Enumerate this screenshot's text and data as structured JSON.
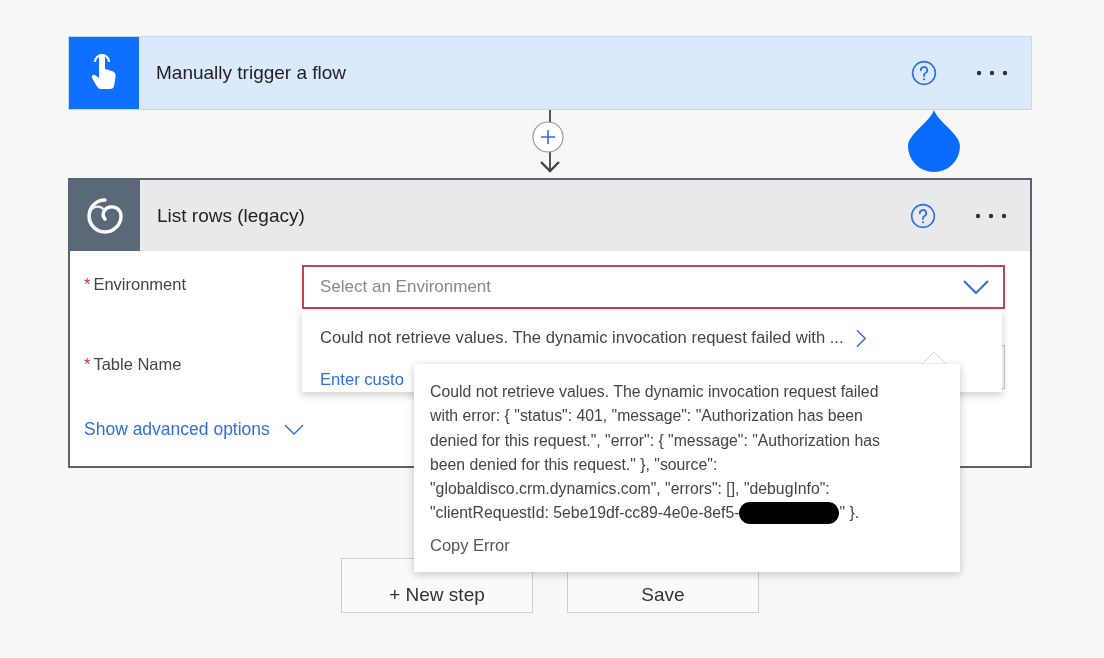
{
  "trigger": {
    "title": "Manually trigger a flow"
  },
  "action": {
    "title": "List rows (legacy)",
    "fields": [
      {
        "label": "Environment",
        "required_mark": "*",
        "placeholder": "Select an Environment",
        "error": true
      },
      {
        "label": "Table Name",
        "required_mark": "*",
        "error": false
      }
    ],
    "advanced_link": "Show advanced options"
  },
  "dropdown": {
    "items": [
      {
        "kind": "error",
        "text": "Could not retrieve values. The dynamic invocation request failed with ..."
      },
      {
        "kind": "custom",
        "text": "Enter custo"
      }
    ]
  },
  "tooltip": {
    "message": "Could not retrieve values. The dynamic invocation request failed with error: { \"status\": 401, \"message\": \"Authorization has been denied for this request.\", \"error\": { \"message\": \"Authorization has been denied for this request.\" }, \"source\": \"globaldisco.crm.dynamics.com\", \"errors\": [], \"debugInfo\": \"clientRequestId: 5ebe19df-cc89-4e0e-8ef5-",
    "message_end": "\" }.",
    "action": "Copy Error"
  },
  "buttons": [
    "+ New step",
    "Save"
  ]
}
